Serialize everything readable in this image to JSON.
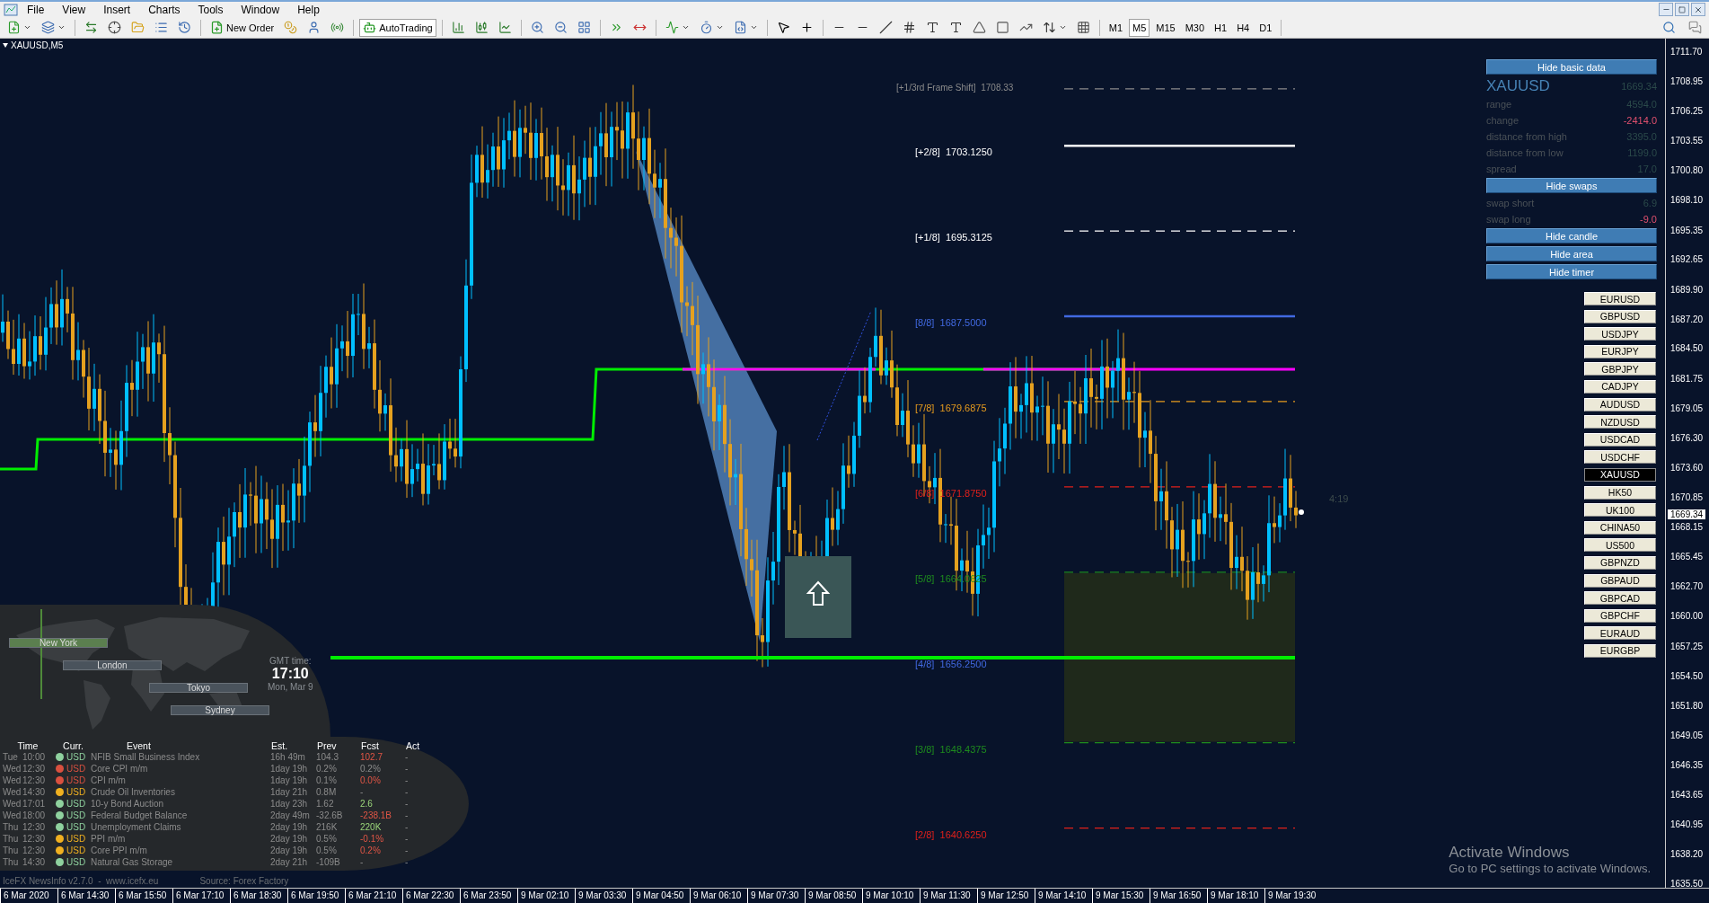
{
  "menu": [
    "File",
    "View",
    "Insert",
    "Charts",
    "Tools",
    "Window",
    "Help"
  ],
  "toolbar": {
    "new_order": "New Order",
    "auto_trading": "AutoTrading",
    "timeframes": [
      {
        "label": "M1",
        "selected": false
      },
      {
        "label": "M5",
        "selected": true
      },
      {
        "label": "M15",
        "selected": false
      },
      {
        "label": "M30",
        "selected": false
      },
      {
        "label": "H1",
        "selected": false
      },
      {
        "label": "H4",
        "selected": false
      },
      {
        "label": "D1",
        "selected": false
      }
    ]
  },
  "chart": {
    "symbol": "XAUUSD,M5",
    "timer": "4:19",
    "current_price": "1669.34",
    "price_axis": [
      "1711.70",
      "1708.95",
      "1706.25",
      "1703.55",
      "1700.80",
      "1698.10",
      "1695.35",
      "1692.65",
      "1689.90",
      "1687.20",
      "1684.50",
      "1681.75",
      "1679.05",
      "1676.30",
      "1673.60",
      "1670.85",
      "1668.15",
      "1665.45",
      "1662.70",
      "1660.00",
      "1657.25",
      "1654.50",
      "1651.80",
      "1649.05",
      "1646.35",
      "1643.65",
      "1640.95",
      "1638.20",
      "1635.50"
    ],
    "time_axis": [
      "6 Mar 2020",
      "6 Mar 14:30",
      "6 Mar 15:50",
      "6 Mar 17:10",
      "6 Mar 18:30",
      "6 Mar 19:50",
      "6 Mar 21:10",
      "6 Mar 22:30",
      "6 Mar 23:50",
      "9 Mar 02:10",
      "9 Mar 03:30",
      "9 Mar 04:50",
      "9 Mar 06:10",
      "9 Mar 07:30",
      "9 Mar 08:50",
      "9 Mar 10:10",
      "9 Mar 11:30",
      "9 Mar 12:50",
      "9 Mar 14:10",
      "9 Mar 15:30",
      "9 Mar 16:50",
      "9 Mar 18:10",
      "9 Mar 19:30"
    ],
    "levels": [
      {
        "label": "[+1/3rd Frame Shift]",
        "value": "1708.33",
        "color": "#8a8a8a",
        "kind": "dashed"
      },
      {
        "label": "[+2/8]",
        "value": "1703.1250",
        "color": "#ffffff",
        "kind": "solid"
      },
      {
        "label": "[+1/8]",
        "value": "1695.3125",
        "color": "#ffffff",
        "kind": "dashed"
      },
      {
        "label": "[8/8]",
        "value": "1687.5000",
        "color": "#4169e1",
        "kind": "solid"
      },
      {
        "label": "[7/8]",
        "value": "1679.6875",
        "color": "#e69b1e",
        "kind": "dashed"
      },
      {
        "label": "[6/8]",
        "value": "1671.8750",
        "color": "#e0201b",
        "kind": "dashed"
      },
      {
        "label": "[5/8]",
        "value": "1664.0625",
        "color": "#1e8c1e",
        "kind": "dashed"
      },
      {
        "label": "[4/8]",
        "value": "1656.2500",
        "color": "#4169e1",
        "kind": "hidden"
      },
      {
        "label": "[3/8]",
        "value": "1648.4375",
        "color": "#1e8c1e",
        "kind": "dashed"
      },
      {
        "label": "[2/8]",
        "value": "1640.6250",
        "color": "#e0201b",
        "kind": "dashed"
      }
    ]
  },
  "info_panel": [
    {
      "kind": "button",
      "label": "Hide basic data"
    },
    {
      "kind": "title",
      "label": "XAUUSD",
      "value": "1669.34"
    },
    {
      "kind": "row",
      "label": "range",
      "value": "4594.0",
      "negative": false
    },
    {
      "kind": "row",
      "label": "change",
      "value": "-2414.0",
      "negative": true
    },
    {
      "kind": "row",
      "label": "distance from high",
      "value": "3395.0",
      "negative": false
    },
    {
      "kind": "row",
      "label": "distance from low",
      "value": "1199.0",
      "negative": false
    },
    {
      "kind": "row",
      "label": "spread",
      "value": "17.0",
      "negative": false
    },
    {
      "kind": "button",
      "label": "Hide swaps"
    },
    {
      "kind": "row",
      "label": "swap short",
      "value": "6.9",
      "negative": false
    },
    {
      "kind": "row",
      "label": "swap long",
      "value": "-9.0",
      "negative": true
    },
    {
      "kind": "button",
      "label": "Hide candle"
    },
    {
      "kind": "button",
      "label": "Hide area"
    },
    {
      "kind": "button",
      "label": "Hide timer"
    }
  ],
  "symbols": [
    {
      "label": "EURUSD",
      "selected": false
    },
    {
      "label": "GBPUSD",
      "selected": false
    },
    {
      "label": "USDJPY",
      "selected": false
    },
    {
      "label": "EURJPY",
      "selected": false
    },
    {
      "label": "GBPJPY",
      "selected": false
    },
    {
      "label": "CADJPY",
      "selected": false
    },
    {
      "label": "AUDUSD",
      "selected": false
    },
    {
      "label": "NZDUSD",
      "selected": false
    },
    {
      "label": "USDCAD",
      "selected": false
    },
    {
      "label": "USDCHF",
      "selected": false
    },
    {
      "label": "XAUUSD",
      "selected": true
    },
    {
      "label": "HK50",
      "selected": false
    },
    {
      "label": "UK100",
      "selected": false
    },
    {
      "label": "CHINA50",
      "selected": false
    },
    {
      "label": "US500",
      "selected": false
    },
    {
      "label": "GBPNZD",
      "selected": false
    },
    {
      "label": "GBPAUD",
      "selected": false
    },
    {
      "label": "GBPCAD",
      "selected": false
    },
    {
      "label": "GBPCHF",
      "selected": false
    },
    {
      "label": "EURAUD",
      "selected": false
    },
    {
      "label": "EURGBP",
      "selected": false
    }
  ],
  "news": {
    "sessions": [
      {
        "label": "New York",
        "active": true
      },
      {
        "label": "London",
        "active": false
      },
      {
        "label": "Tokyo",
        "active": false
      },
      {
        "label": "Sydney",
        "active": false
      }
    ],
    "clock": {
      "caption": "GMT time:",
      "time": "17:10",
      "date": "Mon, Mar 9"
    },
    "columns": [
      "Time",
      "Curr.",
      "Event",
      "Est.",
      "Prev",
      "Fcst",
      "Act"
    ],
    "rows": [
      {
        "day": "Tue",
        "time": "10:00",
        "color": "#8fd19e",
        "currency": "USD",
        "event": "NFIB Small Business Index",
        "est": "16h 49m",
        "prev": "104.3",
        "fcst": "102.7",
        "fcst_worse": true,
        "fcst_better": false,
        "act": "-"
      },
      {
        "day": "Wed",
        "time": "12:30",
        "color": "#d9503f",
        "currency": "USD",
        "event": "Core CPI m/m",
        "est": "1day 19h",
        "prev": "0.2%",
        "fcst": "0.2%",
        "fcst_worse": false,
        "fcst_better": false,
        "act": "-"
      },
      {
        "day": "Wed",
        "time": "12:30",
        "color": "#d9503f",
        "currency": "USD",
        "event": "CPI m/m",
        "est": "1day 19h",
        "prev": "0.1%",
        "fcst": "0.0%",
        "fcst_worse": true,
        "fcst_better": false,
        "act": "-"
      },
      {
        "day": "Wed",
        "time": "14:30",
        "color": "#f0b020",
        "currency": "USD",
        "event": "Crude Oil Inventories",
        "est": "1day 21h",
        "prev": "0.8M",
        "fcst": "-",
        "fcst_worse": false,
        "fcst_better": false,
        "act": "-"
      },
      {
        "day": "Wed",
        "time": "17:01",
        "color": "#8fd19e",
        "currency": "USD",
        "event": "10-y Bond Auction",
        "est": "1day 23h",
        "prev": "1.62",
        "fcst": "2.6",
        "fcst_worse": false,
        "fcst_better": true,
        "act": "-"
      },
      {
        "day": "Wed",
        "time": "18:00",
        "color": "#8fd19e",
        "currency": "USD",
        "event": "Federal Budget Balance",
        "est": "2day 49m",
        "prev": "-32.6B",
        "fcst": "-238.1B",
        "fcst_worse": true,
        "fcst_better": false,
        "act": "-"
      },
      {
        "day": "Thu",
        "time": "12:30",
        "color": "#8fd19e",
        "currency": "USD",
        "event": "Unemployment Claims",
        "est": "2day 19h",
        "prev": "216K",
        "fcst": "220K",
        "fcst_worse": false,
        "fcst_better": true,
        "act": "-"
      },
      {
        "day": "Thu",
        "time": "12:30",
        "color": "#f0b020",
        "currency": "USD",
        "event": "PPI m/m",
        "est": "2day 19h",
        "prev": "0.5%",
        "fcst": "-0.1%",
        "fcst_worse": true,
        "fcst_better": false,
        "act": "-"
      },
      {
        "day": "Thu",
        "time": "12:30",
        "color": "#f0b020",
        "currency": "USD",
        "event": "Core PPI m/m",
        "est": "2day 19h",
        "prev": "0.5%",
        "fcst": "0.2%",
        "fcst_worse": true,
        "fcst_better": false,
        "act": "-"
      },
      {
        "day": "Thu",
        "time": "14:30",
        "color": "#8fd19e",
        "currency": "USD",
        "event": "Natural Gas Storage",
        "est": "2day 21h",
        "prev": "-109B",
        "fcst": "-",
        "fcst_worse": false,
        "fcst_better": false,
        "act": "-"
      }
    ],
    "footer": "IceFX NewsInfo v2.7.0  -  www.icefx.eu",
    "source": "Source: Forex Factory"
  },
  "os_notice": {
    "title": "Activate Windows",
    "text": "Go to PC settings to activate Windows."
  }
}
